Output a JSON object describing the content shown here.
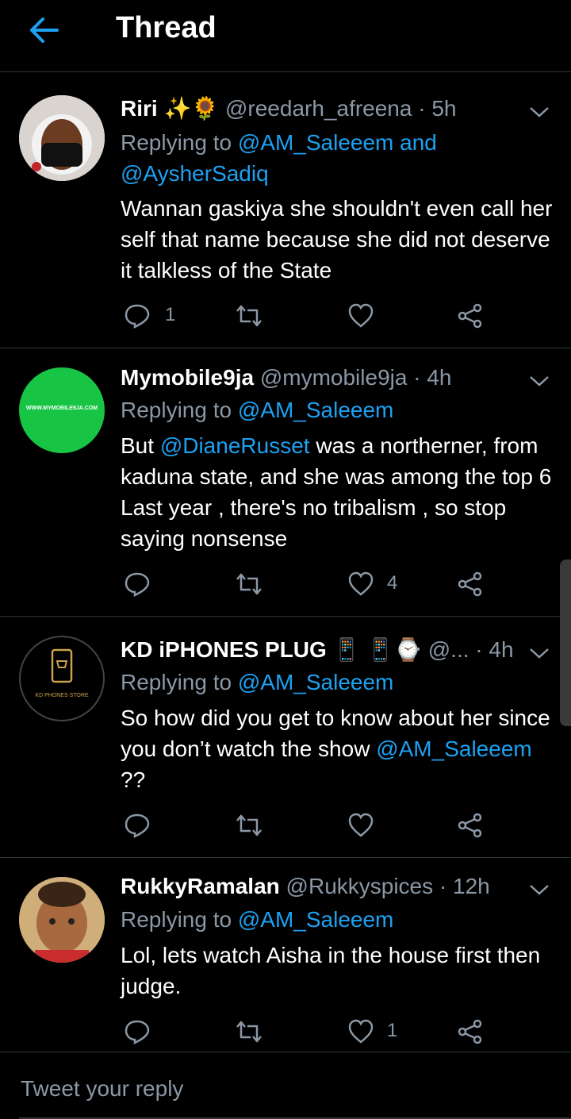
{
  "header": {
    "title": "Thread"
  },
  "tweets": [
    {
      "name": "Riri",
      "emoji": "✨🌻",
      "handle": "@reedarh_afreena",
      "time": "· 5h",
      "replying_prefix": "Replying to ",
      "reply_line1_link": "@AM_Saleeem and",
      "reply_line2_link": "@AysherSadiq",
      "body": "Wannan gaskiya she shouldn't even call her self that name because she did not deserve it talkless of the State",
      "reply_count": "1",
      "like_count": ""
    },
    {
      "name": "Mymobile9ja",
      "handle": "@mymobile9ja",
      "time": "· 4h",
      "avatar_text": "WWW.MYMOBILE9JA.COM",
      "replying_prefix": "Replying to ",
      "reply_link": "@AM_Saleeem",
      "body_mention": "@DianeRusset",
      "body_pre": "But ",
      "body_post": " was a northerner, from kaduna state,  and she was among the top 6 Last year , there's no tribalism , so stop saying nonsense",
      "reply_count": "",
      "like_count": "4"
    },
    {
      "name": "KD iPHONES PLUG",
      "emoji": "📱 📱⌚",
      "handle": "@...",
      "time": "· 4h",
      "avatar_text": "KD PHONES STORE",
      "replying_prefix": "Replying to ",
      "reply_link": "@AM_Saleeem",
      "body_pre": "So how did you get to know about her since you don’t watch the show ",
      "body_mention": "@AM_Saleeem",
      "body_post": " ??",
      "reply_count": "",
      "like_count": ""
    },
    {
      "name": "RukkyRamalan",
      "handle": "@Rukkyspices",
      "time": "· 12h",
      "replying_prefix": "Replying to ",
      "reply_link": "@AM_Saleeem",
      "body": "Lol, lets watch Aisha in the house first then judge.",
      "reply_count": "",
      "like_count": "1"
    }
  ],
  "composer": {
    "placeholder": "Tweet your reply"
  },
  "colors": {
    "background": "#000000",
    "link": "#1da1f2",
    "muted": "#8b98a5",
    "divider": "#2f3336",
    "avatar2": "#17c444"
  }
}
